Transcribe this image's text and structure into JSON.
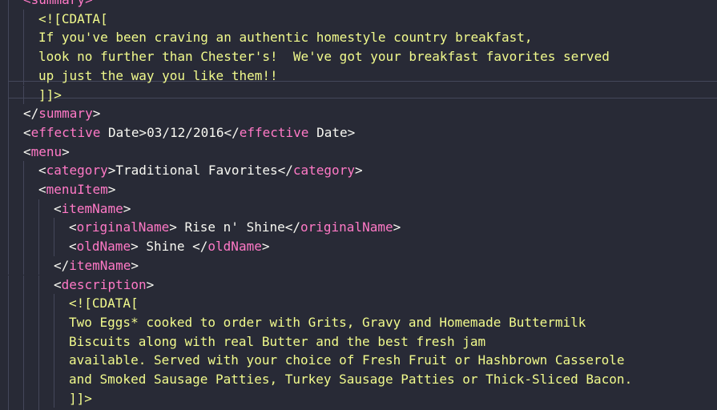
{
  "editor": {
    "lines": [
      {
        "indent": 1,
        "segments": [
          {
            "cls": "t-tag",
            "text": "<summary>"
          }
        ]
      },
      {
        "indent": 2,
        "segments": [
          {
            "cls": "t-cdata",
            "text": "<![CDATA["
          }
        ]
      },
      {
        "indent": 2,
        "segments": [
          {
            "cls": "t-cdata",
            "text": "If you've been craving an authentic homestyle country breakfast,"
          }
        ]
      },
      {
        "indent": 2,
        "segments": [
          {
            "cls": "t-cdata",
            "text": "look no further than Chester's!  We've got your breakfast favorites served"
          }
        ]
      },
      {
        "indent": 2,
        "segments": [
          {
            "cls": "t-cdata",
            "text": "up just the way you like them!!"
          }
        ]
      },
      {
        "indent": 2,
        "segments": [
          {
            "cls": "t-cdata",
            "text": "]]>"
          }
        ]
      },
      {
        "indent": 1,
        "segments": [
          {
            "cls": "t-punct",
            "text": "</"
          },
          {
            "cls": "t-tag",
            "text": "summary"
          },
          {
            "cls": "t-punct",
            "text": ">"
          }
        ]
      },
      {
        "indent": 1,
        "segments": [
          {
            "cls": "t-punct",
            "text": "<"
          },
          {
            "cls": "t-tag",
            "text": "effective"
          },
          {
            "cls": "t-text",
            "text": " Date>03/12/2016</"
          },
          {
            "cls": "t-tag",
            "text": "effective"
          },
          {
            "cls": "t-text",
            "text": " Date>"
          }
        ]
      },
      {
        "indent": 1,
        "segments": [
          {
            "cls": "t-punct",
            "text": "<"
          },
          {
            "cls": "t-tag",
            "text": "menu"
          },
          {
            "cls": "t-punct",
            "text": ">"
          }
        ]
      },
      {
        "indent": 2,
        "segments": [
          {
            "cls": "t-punct",
            "text": "<"
          },
          {
            "cls": "t-tag",
            "text": "category"
          },
          {
            "cls": "t-text",
            "text": ">Traditional Favorites</"
          },
          {
            "cls": "t-tag",
            "text": "category"
          },
          {
            "cls": "t-punct",
            "text": ">"
          }
        ]
      },
      {
        "indent": 2,
        "segments": [
          {
            "cls": "t-punct",
            "text": "<"
          },
          {
            "cls": "t-tag",
            "text": "menuItem"
          },
          {
            "cls": "t-punct",
            "text": ">"
          }
        ]
      },
      {
        "indent": 3,
        "segments": [
          {
            "cls": "t-punct",
            "text": "<"
          },
          {
            "cls": "t-tag",
            "text": "itemName"
          },
          {
            "cls": "t-punct",
            "text": ">"
          }
        ]
      },
      {
        "indent": 4,
        "segments": [
          {
            "cls": "t-punct",
            "text": "<"
          },
          {
            "cls": "t-tag",
            "text": "originalName"
          },
          {
            "cls": "t-text",
            "text": "> Rise n' Shine</"
          },
          {
            "cls": "t-tag",
            "text": "originalName"
          },
          {
            "cls": "t-punct",
            "text": ">"
          }
        ]
      },
      {
        "indent": 4,
        "segments": [
          {
            "cls": "t-punct",
            "text": "<"
          },
          {
            "cls": "t-tag",
            "text": "oldName"
          },
          {
            "cls": "t-text",
            "text": "> Shine </"
          },
          {
            "cls": "t-tag",
            "text": "oldName"
          },
          {
            "cls": "t-punct",
            "text": ">"
          }
        ]
      },
      {
        "indent": 3,
        "segments": [
          {
            "cls": "t-punct",
            "text": "</"
          },
          {
            "cls": "t-tag",
            "text": "itemName"
          },
          {
            "cls": "t-punct",
            "text": ">"
          }
        ]
      },
      {
        "indent": 3,
        "segments": [
          {
            "cls": "t-punct",
            "text": "<"
          },
          {
            "cls": "t-tag",
            "text": "description"
          },
          {
            "cls": "t-punct",
            "text": ">"
          }
        ]
      },
      {
        "indent": 4,
        "segments": [
          {
            "cls": "t-cdata",
            "text": "<![CDATA["
          }
        ]
      },
      {
        "indent": 4,
        "segments": [
          {
            "cls": "t-cdata",
            "text": "Two Eggs* cooked to order with Grits, Gravy and Homemade Buttermilk"
          }
        ]
      },
      {
        "indent": 4,
        "segments": [
          {
            "cls": "t-cdata",
            "text": "Biscuits along with real Butter and the best fresh jam"
          }
        ]
      },
      {
        "indent": 4,
        "segments": [
          {
            "cls": "t-cdata",
            "text": "available. Served with your choice of Fresh Fruit or Hashbrown Casserole"
          }
        ]
      },
      {
        "indent": 4,
        "segments": [
          {
            "cls": "t-cdata",
            "text": "and Smoked Sausage Patties, Turkey Sausage Patties or Thick-Sliced Bacon."
          }
        ]
      },
      {
        "indent": 4,
        "segments": [
          {
            "cls": "t-cdata",
            "text": "]]>"
          }
        ]
      },
      {
        "indent": 3,
        "segments": [
          {
            "cls": "t-punct",
            "text": "</"
          },
          {
            "cls": "t-tag",
            "text": "description"
          },
          {
            "cls": "t-punct",
            "text": ">"
          }
        ]
      }
    ]
  },
  "colors": {
    "background": "#282a36",
    "tag": "#ff79c6",
    "text": "#f8f8f2",
    "cdata": "#f1fa8c",
    "indent_guide": "#44475a"
  }
}
